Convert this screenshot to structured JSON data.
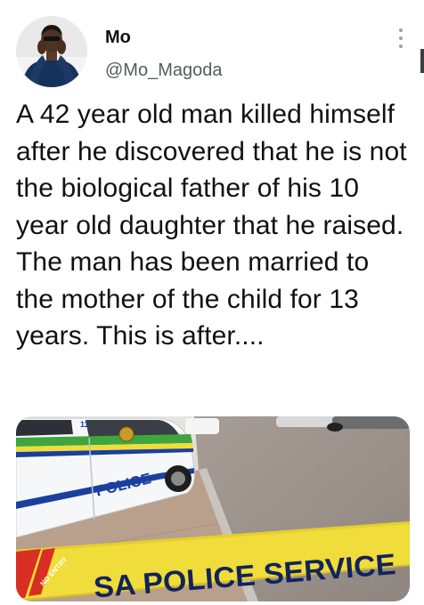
{
  "tweet": {
    "author": {
      "name": "Mo",
      "handle": "@Mo_Magoda",
      "avatar_icon": "profile-photo-avatar"
    },
    "text": "A 42 year old man killed himself after he discovered that he is not the biological father of his 10 year old daughter that he raised. The man has been married to the mother of the child for 13 years. This is after....",
    "more_icon": "more-vertical-icon"
  },
  "media": {
    "van_police_label": "POLICE",
    "van_plate_text": "11",
    "tape_text": "SA POLICE SERVICE",
    "tape_small_text": "NO ENTRY"
  },
  "colors": {
    "police_blue": "#1b3f9e",
    "tape_yellow": "#f0dc3a",
    "police_green": "#3fa63f"
  }
}
